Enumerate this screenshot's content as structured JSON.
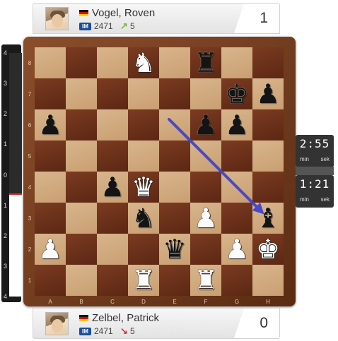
{
  "top_player": {
    "name": "Vogel, Roven",
    "flag": "flag-germany-icon",
    "title": "IM",
    "rating": "2471",
    "rating_trend": "up",
    "rating_trend_icon": "arrow-up-right-icon",
    "rating_change": "5",
    "score": "1"
  },
  "bottom_player": {
    "name": "Zelbel, Patrick",
    "flag": "flag-germany-icon",
    "title": "IM",
    "rating": "2471",
    "rating_trend": "down",
    "rating_trend_icon": "arrow-down-right-icon",
    "rating_change": "5",
    "score": "0"
  },
  "clocks": {
    "top": {
      "time": "2:55",
      "unit_min": "min",
      "unit_sec": "sek"
    },
    "bottom": {
      "time": "1:21",
      "unit_min": "min",
      "unit_sec": "sek"
    }
  },
  "eval_bar": {
    "labels": [
      "4",
      "3",
      "2",
      "1",
      "0",
      "1",
      "2",
      "3",
      "4"
    ],
    "white_fraction": 0.42,
    "midline_color": "#d9322b"
  },
  "board": {
    "files": [
      "A",
      "B",
      "C",
      "D",
      "E",
      "F",
      "G",
      "H"
    ],
    "ranks": [
      "8",
      "7",
      "6",
      "5",
      "4",
      "3",
      "2",
      "1"
    ],
    "light_color": "#d0a87e",
    "dark_color": "#6b311a",
    "pieces": [
      {
        "square": "d8",
        "color": "w",
        "type": "N"
      },
      {
        "square": "f8",
        "color": "b",
        "type": "R"
      },
      {
        "square": "g7",
        "color": "b",
        "type": "K"
      },
      {
        "square": "h7",
        "color": "b",
        "type": "P"
      },
      {
        "square": "a6",
        "color": "b",
        "type": "P"
      },
      {
        "square": "f6",
        "color": "b",
        "type": "P"
      },
      {
        "square": "g6",
        "color": "b",
        "type": "P"
      },
      {
        "square": "c4",
        "color": "b",
        "type": "P"
      },
      {
        "square": "d4",
        "color": "w",
        "type": "Q"
      },
      {
        "square": "d3",
        "color": "b",
        "type": "N"
      },
      {
        "square": "f3",
        "color": "w",
        "type": "P"
      },
      {
        "square": "h3",
        "color": "b",
        "type": "B"
      },
      {
        "square": "a2",
        "color": "w",
        "type": "P"
      },
      {
        "square": "e2",
        "color": "b",
        "type": "Q"
      },
      {
        "square": "g2",
        "color": "w",
        "type": "P"
      },
      {
        "square": "h2",
        "color": "w",
        "type": "K"
      },
      {
        "square": "d1",
        "color": "w",
        "type": "R"
      },
      {
        "square": "f1",
        "color": "w",
        "type": "R"
      }
    ],
    "arrow": {
      "from": "e6",
      "to": "h3",
      "color": "#3a3fd1"
    }
  }
}
